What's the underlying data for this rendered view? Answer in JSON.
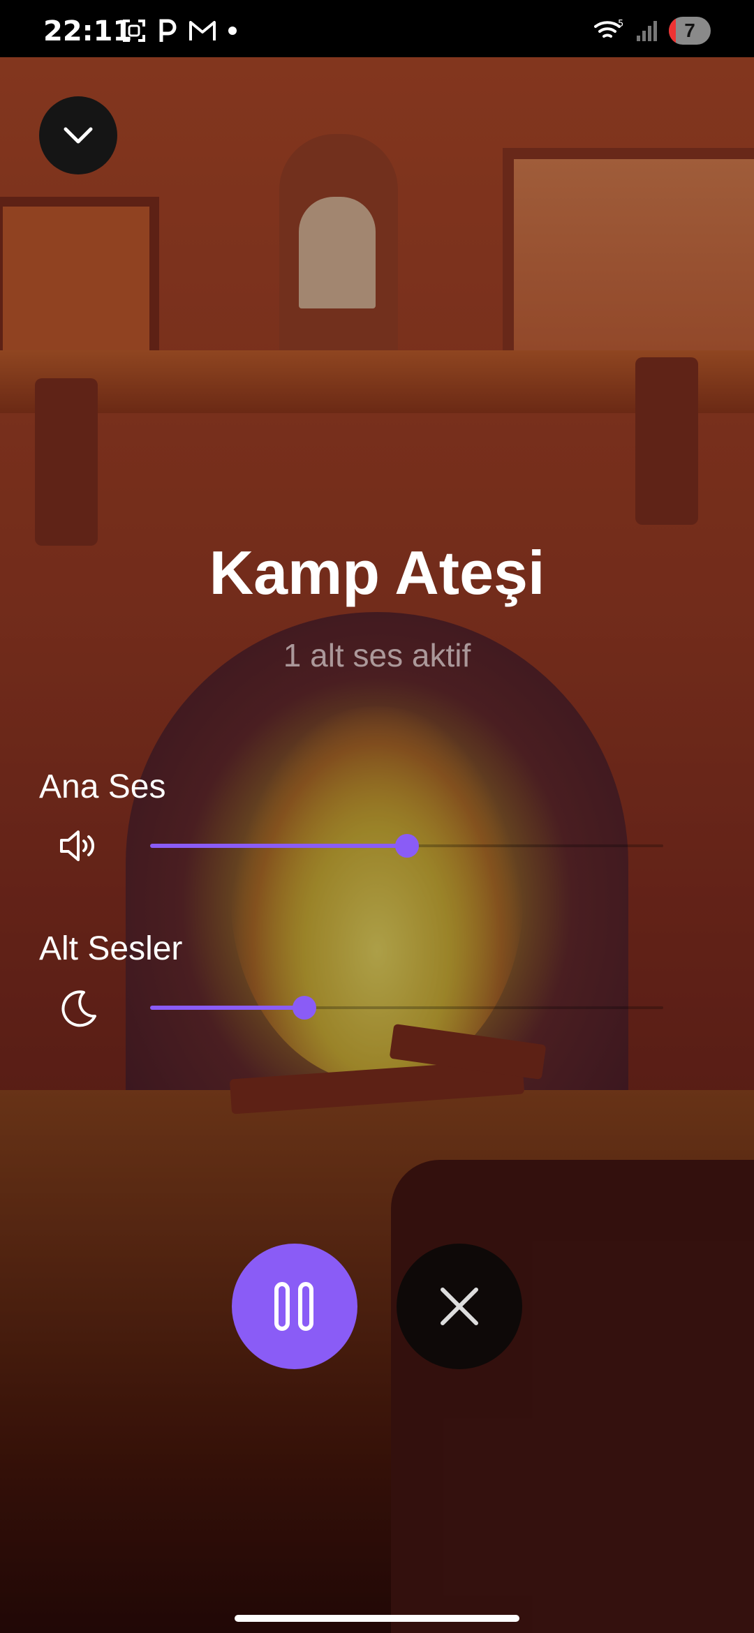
{
  "status_bar": {
    "time": "22:11",
    "notification_icons": [
      "screenshot-icon",
      "p-app-icon",
      "gmail-icon",
      "dot-icon"
    ],
    "battery_level": "7",
    "wifi_badge": "5"
  },
  "player": {
    "title": "Kamp Ateşi",
    "subtitle": "1 alt ses aktif",
    "main_volume": {
      "label": "Ana Ses",
      "icon": "speaker-icon",
      "value": 0.5
    },
    "sub_sounds": {
      "label": "Alt Sesler",
      "icon": "moon-icon",
      "value": 0.3
    },
    "accent_color": "#8a5cf6"
  },
  "controls": {
    "collapse_icon": "chevron-down-icon",
    "pause_icon": "pause-icon",
    "close_icon": "close-icon"
  }
}
